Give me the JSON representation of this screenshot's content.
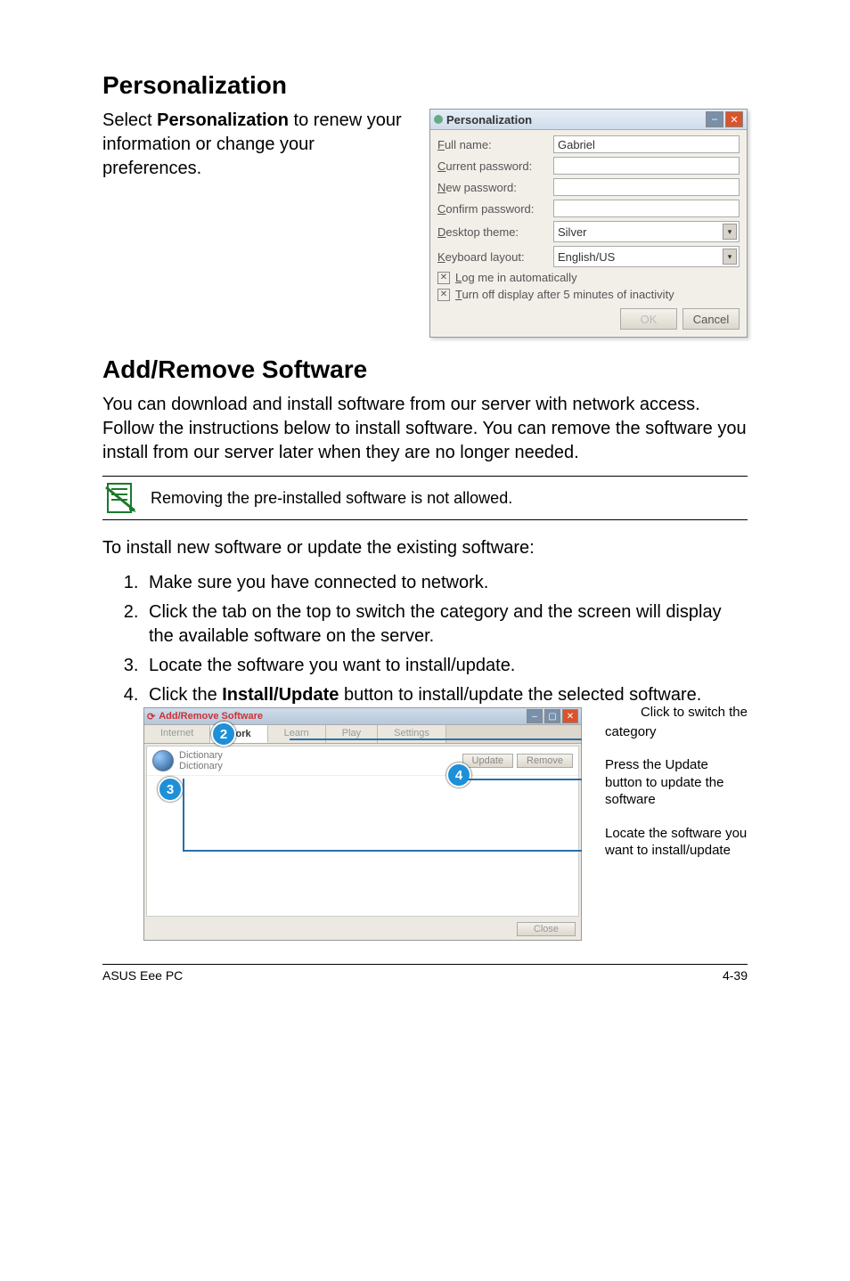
{
  "section1": {
    "heading": "Personalization",
    "intro_pre": "Select ",
    "intro_bold": "Personalization",
    "intro_post": " to renew your information or change your preferences."
  },
  "pers_dialog": {
    "title": "Personalization",
    "full_name_label": "Full name:",
    "full_name_value": "Gabriel",
    "current_pw_label": "Current password:",
    "new_pw_label": "New password:",
    "confirm_pw_label": "Confirm password:",
    "theme_label": "Desktop theme:",
    "theme_value": "Silver",
    "kb_label": "Keyboard layout:",
    "kb_value": "English/US",
    "check1": "Log me in automatically",
    "check2": "Turn off display after 5 minutes of inactivity",
    "ok": "OK",
    "cancel": "Cancel"
  },
  "section2": {
    "heading": "Add/Remove Software",
    "body": "You can download and install software from our server with network access. Follow the instructions below to install software. You can remove the software you install from our server later when they are no longer needed.",
    "note": "Removing the pre-installed software is not allowed.",
    "lead": "To install new software or update the existing software:",
    "steps": [
      "Make sure you have connected to network.",
      "Click the tab on the top to switch the category and the screen will display the available software on the server.",
      "Locate the software you want to install/update.",
      ""
    ],
    "step4_pre": "Click the ",
    "step4_bold": "Install/Update",
    "step4_post": " button to install/update the selected software."
  },
  "addrem": {
    "title": "Add/Remove Software",
    "tabs": [
      "Internet",
      "Work",
      "Learn",
      "Play",
      "Settings"
    ],
    "item_name1": "Dictionary",
    "item_name2": "Dictionary",
    "update_btn": "Update",
    "remove_btn": "Remove",
    "close_btn": "Close"
  },
  "callouts": {
    "pre": "Click to switch the",
    "c1": "category",
    "c2": "Press the Update button to update the software",
    "c3": "Locate the software you want to install/update"
  },
  "footer": {
    "left": "ASUS Eee PC",
    "right": "4-39"
  }
}
